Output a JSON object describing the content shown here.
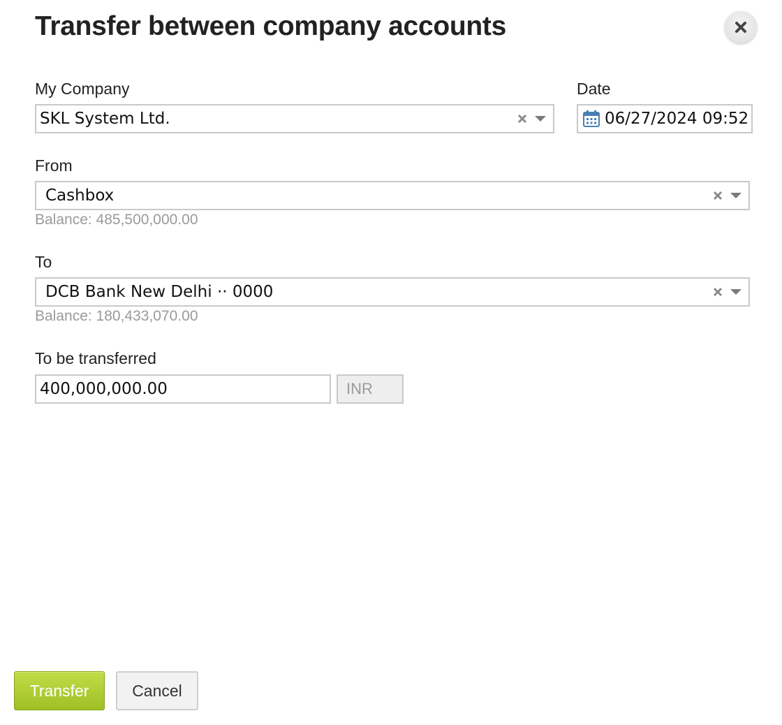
{
  "dialog": {
    "title": "Transfer between company accounts"
  },
  "icons": {
    "close": "close-icon",
    "clear": "clear-x-icon",
    "dropdown": "chevron-down-icon",
    "calendar": "calendar-icon"
  },
  "colors": {
    "primary_button": "#a8c62e",
    "calendar_icon": "#4a7fb5",
    "hint_text": "#9a9a9a"
  },
  "form": {
    "company": {
      "label": "My Company",
      "value": "SKL System Ltd."
    },
    "date": {
      "label": "Date",
      "value": "06/27/2024 09:52"
    },
    "from": {
      "label": "From",
      "value": "Cashbox",
      "balance": "Balance: 485,500,000.00"
    },
    "to": {
      "label": "To",
      "value": "DCB Bank New Delhi ·· 0000",
      "balance": "Balance: 180,433,070.00"
    },
    "amount": {
      "label": "To be transferred",
      "value": "400,000,000.00",
      "currency": "INR"
    }
  },
  "buttons": {
    "transfer": "Transfer",
    "cancel": "Cancel"
  }
}
